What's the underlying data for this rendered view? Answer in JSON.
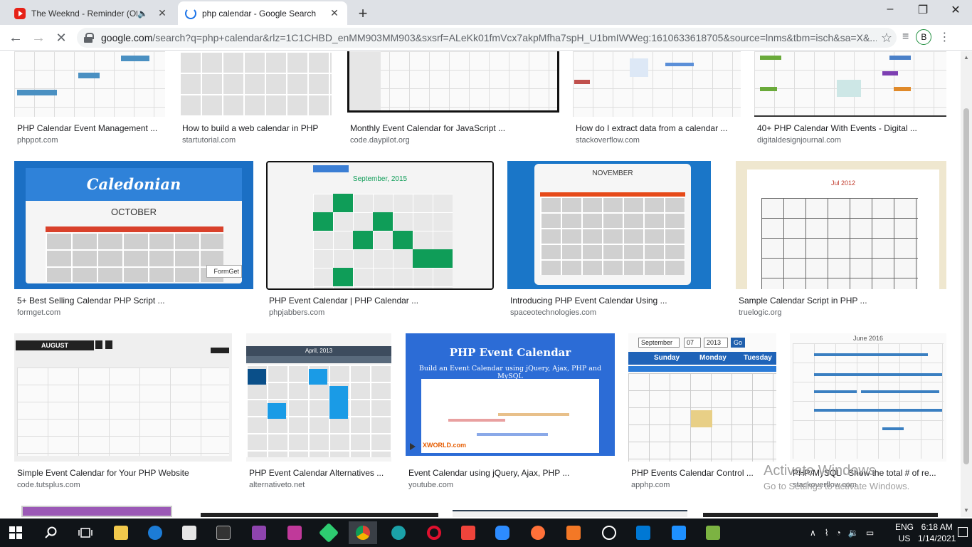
{
  "browser": {
    "tabs": [
      {
        "title": "The Weeknd - Reminder (Offici",
        "favicon": "youtube-icon"
      },
      {
        "title": "php calendar - Google Search",
        "favicon": "loading-spinner-icon"
      }
    ],
    "new_tab": "+",
    "controls": {
      "minimize": "–",
      "maximize": "❐",
      "close": "✕"
    },
    "address": {
      "host": "google.com",
      "rest": "/search?q=php+calendar&rlz=1C1CHBD_enMM903MM903&sxsrf=ALeKk01fmVcx7akpMfha7spH_U1bmIWWeg:1610633618705&source=lnms&tbm=isch&sa=X&..."
    },
    "avatar_letter": "B"
  },
  "results": [
    {
      "caption": "PHP Calendar Event Management ...",
      "source": "phppot.com"
    },
    {
      "caption": "How to build a web calendar in PHP",
      "source": "startutorial.com"
    },
    {
      "caption": "Monthly Event Calendar for JavaScript ...",
      "source": "code.daypilot.org"
    },
    {
      "caption": "How do I extract data from a calendar ...",
      "source": "stackoverflow.com"
    },
    {
      "caption": "40+ PHP Calendar With Events - Digital ...",
      "source": "digitaldesignjournal.com"
    },
    {
      "caption": "5+ Best Selling Calendar PHP Script ...",
      "source": "formget.com"
    },
    {
      "caption": "PHP Event Calendar | PHP Calendar ...",
      "source": "phpjabbers.com"
    },
    {
      "caption": "Introducing PHP Event Calendar Using ...",
      "source": "spaceotechnologies.com"
    },
    {
      "caption": "Sample Calendar Script in PHP ...",
      "source": "truelogic.org"
    },
    {
      "caption": "Simple Event Calendar for Your PHP Website",
      "source": "code.tutsplus.com"
    },
    {
      "caption": "PHP Event Calendar Alternatives ...",
      "source": "alternativeto.net"
    },
    {
      "caption": "Event Calendar using jQuery, Ajax, PHP ...",
      "source": "youtube.com"
    },
    {
      "caption": "PHP Events Calendar Control ...",
      "source": "apphp.com"
    },
    {
      "caption": "PHP/MySQL - Show the total # of re...",
      "source": "stackoverflow.com"
    }
  ],
  "thumb_text": {
    "caledonian": "Caledonian",
    "october": "OCTOBER",
    "formget": "FormGet",
    "september": "September, 2015",
    "november": "NOVEMBER",
    "jul": "Jul 2012",
    "august": "AUGUST",
    "april": "April, 2013",
    "php_event_title": "PHP Event Calendar",
    "php_event_sub": "Build an Event Calendar using jQuery, Ajax, PHP and MySQL",
    "xworld": "XWORLD.com",
    "apphp_month": "September",
    "apphp_day": "07",
    "apphp_year": "2013",
    "apphp_go": "Go",
    "apphp_sunday": "Sunday",
    "apphp_monday": "Monday",
    "apphp_tuesday": "Tuesday",
    "june": "June 2016"
  },
  "watermark": {
    "title": "Activate Windows",
    "subtitle": "Go to Settings to activate Windows."
  },
  "taskbar": {
    "language": "ENG",
    "region": "US",
    "time": "6:18 AM",
    "date": "1/14/2021"
  },
  "colors": {
    "green": "#0f9d58",
    "blue": "#1a73e8",
    "php_blue": "#2c6cd6",
    "red_header": "#e64a19"
  }
}
